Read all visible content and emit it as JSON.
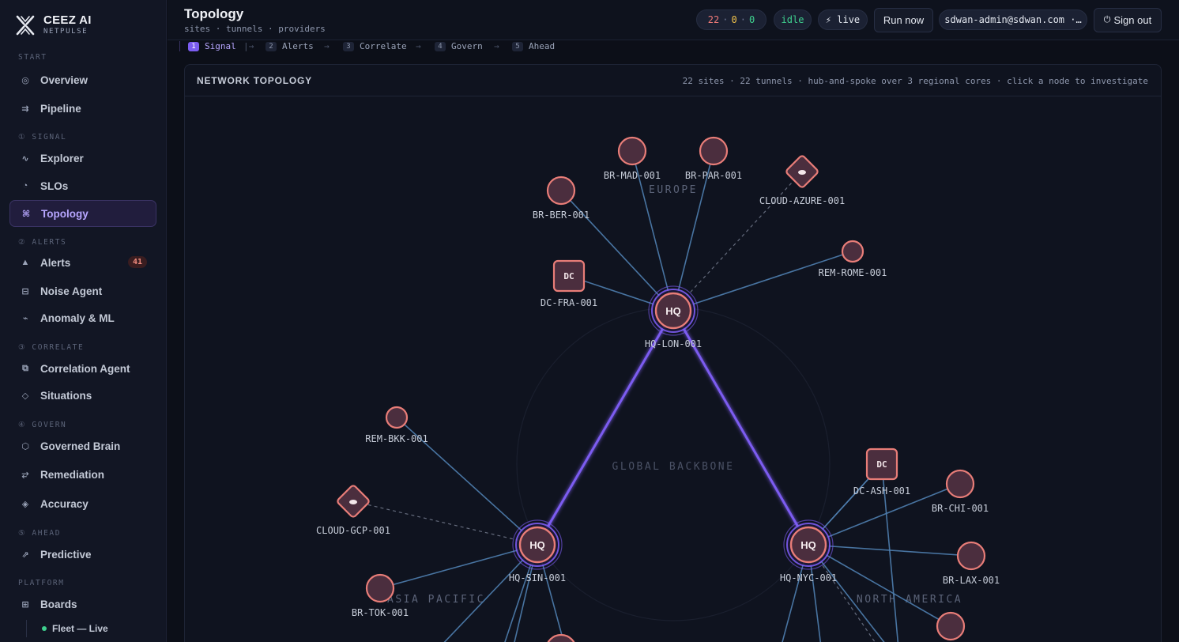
{
  "brand": {
    "name": "CEEZ AI",
    "sub": "NETPULSE"
  },
  "sidebar": {
    "sections": {
      "start": "START",
      "signal": "① SIGNAL",
      "alerts": "② ALERTS",
      "correlate": "③ CORRELATE",
      "govern": "④ GOVERN",
      "ahead": "⑤ AHEAD",
      "platform": "PLATFORM"
    },
    "items": {
      "overview": {
        "label": "Overview",
        "icon": "◎"
      },
      "pipeline": {
        "label": "Pipeline",
        "icon": "⇉"
      },
      "explorer": {
        "label": "Explorer",
        "icon": "∿"
      },
      "slos": {
        "label": "SLOs",
        "icon": "◔"
      },
      "topology": {
        "label": "Topology",
        "icon": "⌘"
      },
      "alerts": {
        "label": "Alerts",
        "icon": "▲",
        "badge": "41"
      },
      "noise_agent": {
        "label": "Noise Agent",
        "icon": "⊟"
      },
      "anomaly": {
        "label": "Anomaly & ML",
        "icon": "⌁"
      },
      "correlation_agent": {
        "label": "Correlation Agent",
        "icon": "⧉"
      },
      "situations": {
        "label": "Situations",
        "icon": "◇"
      },
      "governed_brain": {
        "label": "Governed Brain",
        "icon": "⬡"
      },
      "remediation": {
        "label": "Remediation",
        "icon": "⥂"
      },
      "accuracy": {
        "label": "Accuracy",
        "icon": "◈"
      },
      "predictive": {
        "label": "Predictive",
        "icon": "⇗"
      },
      "boards": {
        "label": "Boards",
        "icon": "⊞"
      },
      "fleet_live": {
        "label": "Fleet — Live"
      }
    }
  },
  "header": {
    "title": "Topology",
    "subtitle": "sites · tunnels · providers",
    "counts": {
      "critical": "22",
      "warn": "0",
      "ok": "0",
      "sep": "·"
    },
    "status": "idle",
    "live": "⚡ live",
    "run_now": "Run now",
    "user": "sdwan-admin@sdwan.com ·…",
    "sign_out": "Sign out",
    "sign_out_icon": "⏻"
  },
  "stepper": [
    {
      "num": "1",
      "label": "Signal"
    },
    {
      "num": "2",
      "label": "Alerts"
    },
    {
      "num": "3",
      "label": "Correlate"
    },
    {
      "num": "4",
      "label": "Govern"
    },
    {
      "num": "5",
      "label": "Ahead"
    }
  ],
  "panel": {
    "title": "NETWORK TOPOLOGY",
    "meta": "22 sites · 22 tunnels · hub-and-spoke over 3 regional cores · click a node to investigate"
  },
  "topology": {
    "regions": [
      "EUROPE",
      "GLOBAL BACKBONE",
      "ASIA PACIFIC",
      "NORTH AMERICA"
    ],
    "hubs": [
      {
        "id": "HQ-LON-001",
        "badge": "HQ"
      },
      {
        "id": "HQ-SIN-001",
        "badge": "HQ"
      },
      {
        "id": "HQ-NYC-001",
        "badge": "HQ"
      }
    ],
    "sites": [
      {
        "id": "BR-MAD-001",
        "type": "branch",
        "hub": "HQ-LON-001"
      },
      {
        "id": "BR-PAR-001",
        "type": "branch",
        "hub": "HQ-LON-001"
      },
      {
        "id": "BR-BER-001",
        "type": "branch",
        "hub": "HQ-LON-001"
      },
      {
        "id": "CLOUD-AZURE-001",
        "type": "cloud",
        "hub": "HQ-LON-001"
      },
      {
        "id": "DC-FRA-001",
        "type": "dc",
        "badge": "DC",
        "hub": "HQ-LON-001"
      },
      {
        "id": "REM-ROME-001",
        "type": "remote",
        "hub": "HQ-LON-001"
      },
      {
        "id": "REM-BKK-001",
        "type": "remote",
        "hub": "HQ-SIN-001"
      },
      {
        "id": "CLOUD-GCP-001",
        "type": "cloud",
        "hub": "HQ-SIN-001"
      },
      {
        "id": "BR-TOK-001",
        "type": "branch",
        "hub": "HQ-SIN-001"
      },
      {
        "id": "DC-ASH-001",
        "type": "dc",
        "badge": "DC",
        "hub": "HQ-NYC-001"
      },
      {
        "id": "BR-CHI-001",
        "type": "branch",
        "hub": "HQ-NYC-001"
      },
      {
        "id": "BR-LAX-001",
        "type": "branch",
        "hub": "HQ-NYC-001"
      }
    ],
    "colors": {
      "background": "#0f131f",
      "node_fill": "#4b2e3e",
      "node_stroke": "#e87d78",
      "spoke": "#4f7fb0",
      "backbone": "#7b5cf0",
      "cloud_link": "#7a8194"
    }
  }
}
